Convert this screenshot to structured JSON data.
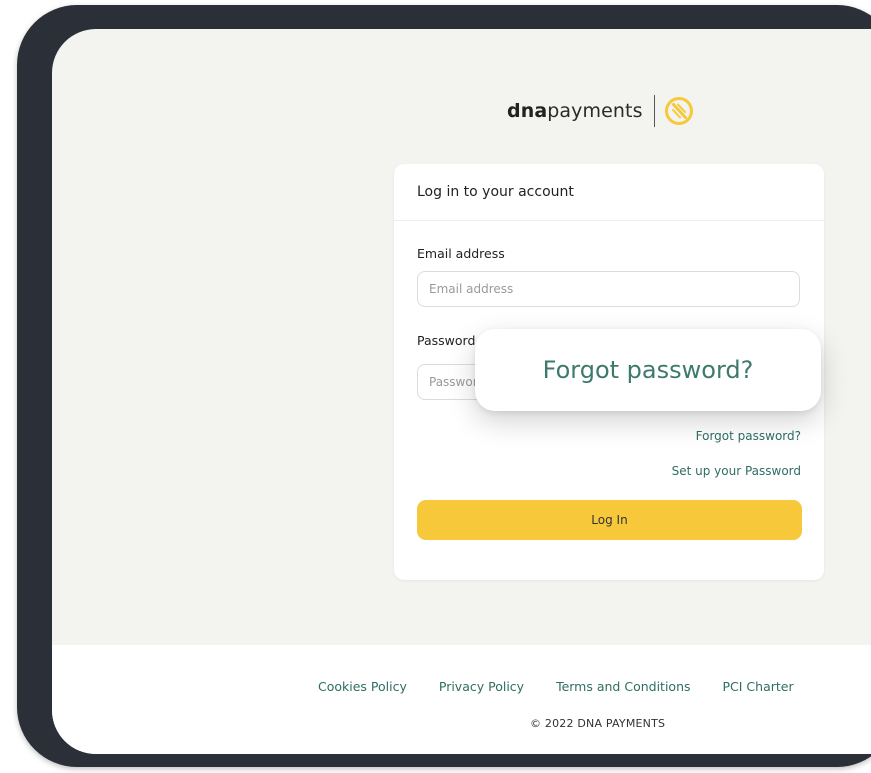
{
  "brand": {
    "name_bold": "dna",
    "name_light": "payments",
    "accent_color": "#f7c83a",
    "link_color": "#2f6e62"
  },
  "login_card": {
    "title": "Log in to your account",
    "email": {
      "label": "Email address",
      "placeholder": "Email address",
      "value": ""
    },
    "password": {
      "label": "Password",
      "placeholder": "Password",
      "value": ""
    },
    "forgot_password_link": "Forgot password?",
    "setup_password_link": "Set up your Password",
    "login_button": "Log In"
  },
  "callout": {
    "text": "Forgot password?"
  },
  "footer": {
    "links": [
      "Cookies Policy",
      "Privacy Policy",
      "Terms and Conditions",
      "PCI Charter"
    ],
    "copyright": "© 2022 DNA PAYMENTS"
  }
}
